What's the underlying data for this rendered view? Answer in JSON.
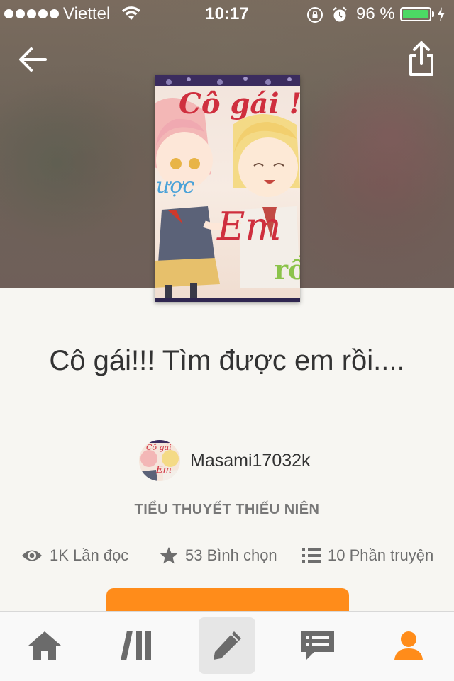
{
  "status_bar": {
    "carrier": "Viettel",
    "time": "10:17",
    "battery_percent": "96 %",
    "battery_level": 0.96,
    "icons": [
      "signal-dots-icon",
      "wifi-icon",
      "rotation-lock-icon",
      "alarm-icon",
      "battery-icon",
      "charging-icon"
    ]
  },
  "header": {
    "back_icon": "arrow-left-icon",
    "share_icon": "share-icon"
  },
  "cover": {
    "lettering": [
      "Cô gái !!",
      "ược",
      "Em",
      "rồ"
    ]
  },
  "story": {
    "title": "Cô gái!!! Tìm được em rồi....",
    "author": "Masami17032k",
    "genre": "TIỂU THUYẾT THIẾU NIÊN"
  },
  "stats": {
    "reads": "1K Lần đọc",
    "votes": "53 Bình chọn",
    "parts": "10 Phần truyện"
  },
  "tab_bar": {
    "items": [
      "home-icon",
      "library-icon",
      "write-icon",
      "messages-icon",
      "profile-icon"
    ],
    "active": "profile-icon"
  },
  "colors": {
    "accent": "#ff8c1a",
    "battery": "#4cd964",
    "page_background": "#f7f6f2",
    "text": "#333333"
  }
}
